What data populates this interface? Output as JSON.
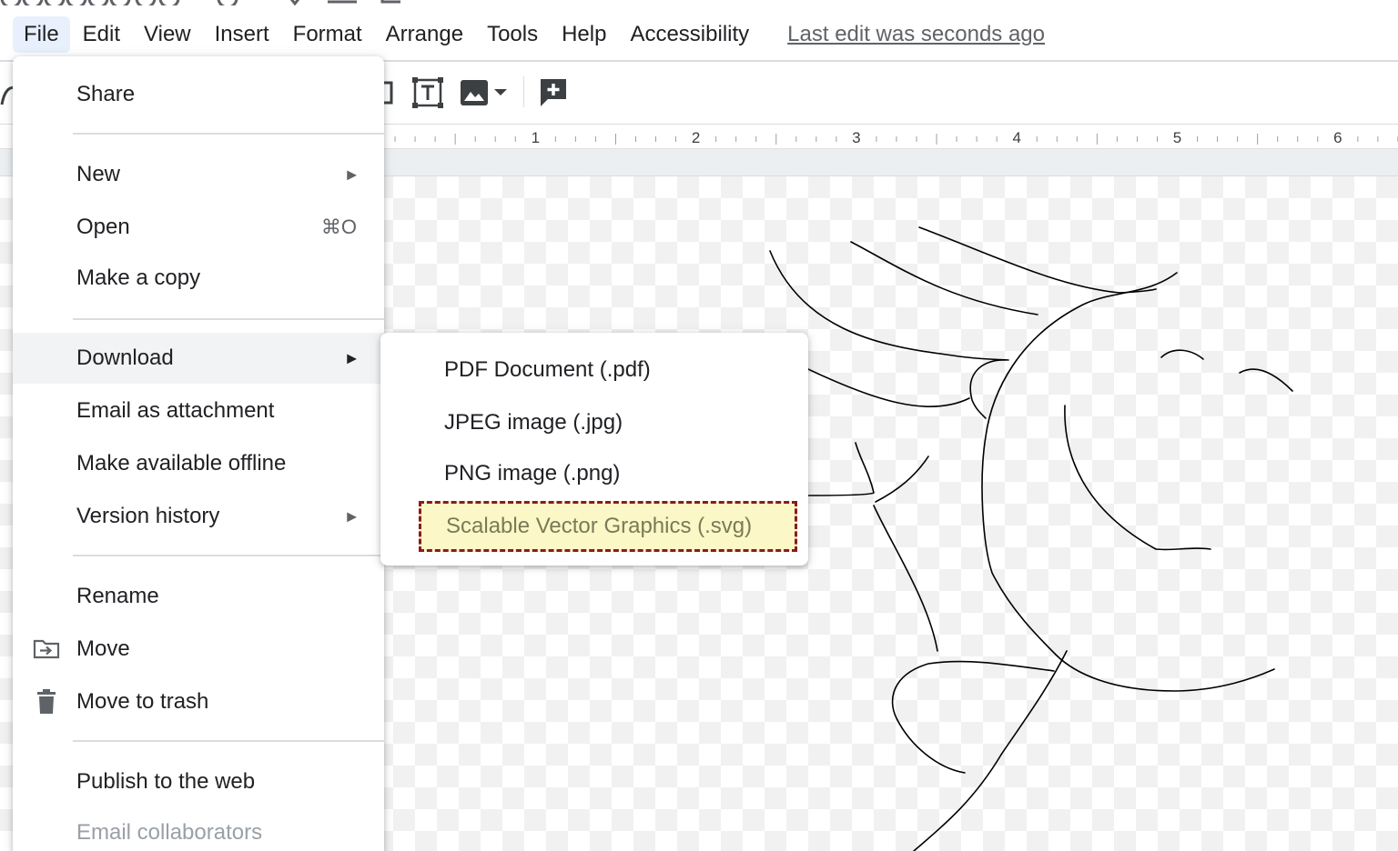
{
  "menubar": {
    "items": [
      "File",
      "Edit",
      "View",
      "Insert",
      "Format",
      "Arrange",
      "Tools",
      "Help",
      "Accessibility"
    ],
    "active": "File",
    "last_edit": "Last edit was seconds ago"
  },
  "toolbar": {
    "icons": [
      "redo-icon",
      "shape-icon",
      "textbox-icon",
      "image-icon",
      "dropdown-caret-icon",
      "add-comment-icon"
    ]
  },
  "ruler": {
    "labels": [
      "1",
      "2",
      "3",
      "4",
      "5",
      "6"
    ]
  },
  "file_menu": {
    "share": "Share",
    "new": "New",
    "open": "Open",
    "open_shortcut": "⌘O",
    "make_copy": "Make a copy",
    "download": "Download",
    "email_attachment": "Email as attachment",
    "make_offline": "Make available offline",
    "version_history": "Version history",
    "rename": "Rename",
    "move": "Move",
    "move_trash": "Move to trash",
    "publish": "Publish to the web",
    "email_collaborators": "Email collaborators"
  },
  "download_menu": {
    "pdf": "PDF Document (.pdf)",
    "jpg": "JPEG image (.jpg)",
    "png": "PNG image (.png)",
    "svg": "Scalable Vector Graphics (.svg)"
  },
  "colors": {
    "menu_active_bg": "#e8f0fe",
    "hover_bg": "#f1f3f4",
    "highlight_bg": "#fbf7c6",
    "highlight_border": "#8b1a1a",
    "disabled_text": "#9aa0a6"
  }
}
